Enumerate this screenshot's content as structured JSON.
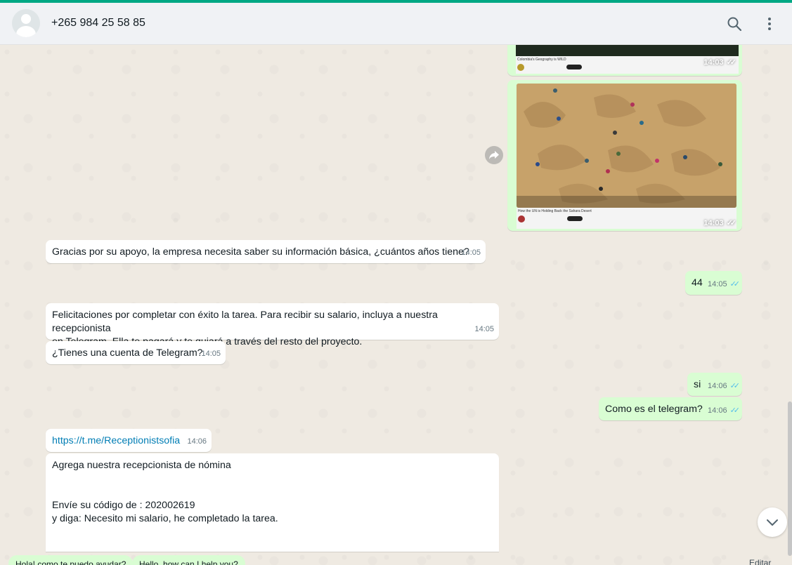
{
  "header": {
    "contact_name": "+265 984 25 58 85"
  },
  "media": [
    {
      "title": "Colombia's Geography is WILD",
      "time": "14:03"
    },
    {
      "title": "How the UN is Holding Back the Sahara Desert",
      "time": "14:03"
    }
  ],
  "messages": [
    {
      "text": "Gracias por su apoyo, la empresa necesita saber su información básica, ¿cuántos años tiene?",
      "time": "14:05"
    },
    {
      "text": "44",
      "time": "14:05"
    },
    {
      "line1": "Felicitaciones por completar con éxito la tarea. Para recibir su salario, incluya a nuestra recepcionista",
      "line2": "en Telegram. Ella te pagará y te guiará a través del resto del proyecto.",
      "time": "14:05"
    },
    {
      "text": "¿Tienes una cuenta de Telegram?",
      "time": "14:05"
    },
    {
      "text": "si",
      "time": "14:06"
    },
    {
      "text": "Como es el telegram?",
      "time": "14:06"
    },
    {
      "text": "https://t.me/Receptionistsofia",
      "time": "14:06"
    },
    {
      "line1": "Agrega  nuestra recepcionista de nómina",
      "line2": "Envíe su código de : 202002619",
      "line3": "y diga: Necesito mi salario, he completado la tarea."
    }
  ],
  "quick_replies": [
    "Hola! como te puedo ayudar?",
    "Hello, how can I help you?"
  ],
  "edit_label": "Editar",
  "colors": {
    "accent": "#00a884",
    "outgoing_bubble": "#d9fdd3",
    "incoming_bubble": "#ffffff",
    "link": "#027eb5",
    "read_ticks": "#53bdeb"
  }
}
